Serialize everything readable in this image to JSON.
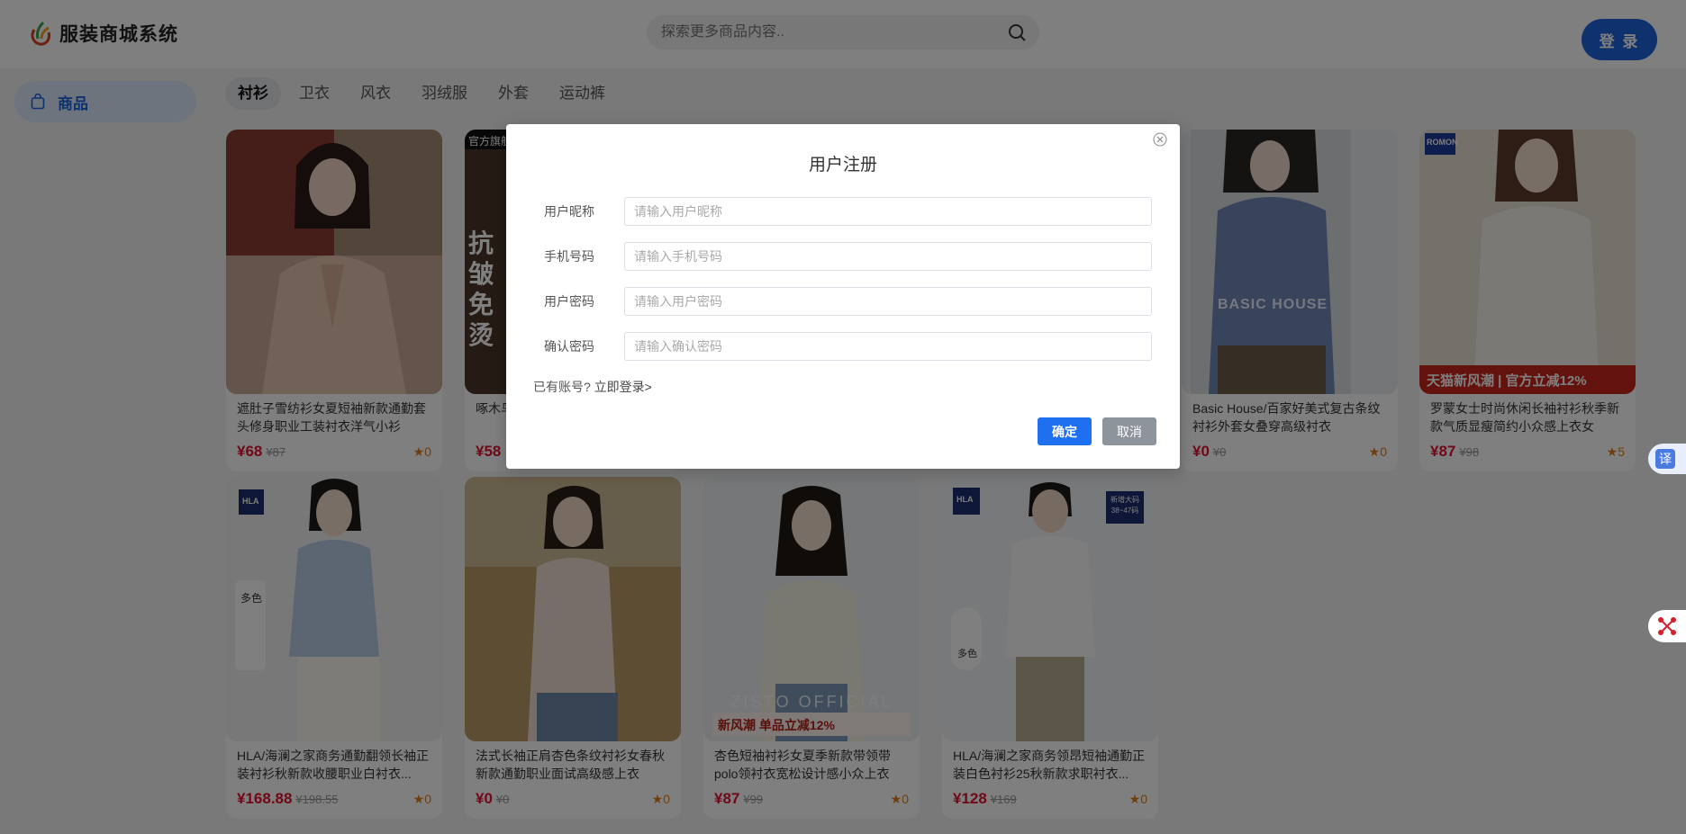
{
  "header": {
    "app_title": "服装商城系统",
    "search_placeholder": "探索更多商品内容..",
    "login_label": "登 录"
  },
  "sidebar": {
    "items": [
      {
        "label": "商品"
      }
    ]
  },
  "tabs": [
    {
      "label": "衬衫",
      "active": true
    },
    {
      "label": "卫衣"
    },
    {
      "label": "风衣"
    },
    {
      "label": "羽绒服"
    },
    {
      "label": "外套"
    },
    {
      "label": "运动裤"
    }
  ],
  "products": [
    {
      "title": "遮肚子雪纺衫女夏短袖新款通勤套头修身职业工装衬衣洋气小衫",
      "price": "¥68",
      "orig": "¥87",
      "fav": "0"
    },
    {
      "title": "啄木鸟正装衬",
      "price": "¥58",
      "orig": "",
      "fav": ""
    },
    {
      "title": "Basic House/百家好美式复古条纹衬衫外套女叠穿高级衬衣",
      "price": "¥0",
      "orig": "¥0",
      "fav": "0"
    },
    {
      "title": "罗蒙女士时尚休闲长袖衬衫秋季新款气质显瘦简约小众感上衣女",
      "price": "¥87",
      "orig": "¥98",
      "fav": "5"
    },
    {
      "title": "HLA/海澜之家商务通勤翻领长袖正装衬衫秋新款收腰职业白衬衣...",
      "price": "¥168.88",
      "orig": "¥198.55",
      "fav": "0"
    },
    {
      "title": "法式长袖正肩杏色条纹衬衫女春秋新款通勤职业面试高级感上衣",
      "price": "¥0",
      "orig": "¥0",
      "fav": "0"
    },
    {
      "title": "杏色短袖衬衫女夏季新款带领带polo领衬衣宽松设计感小众上衣",
      "price": "¥87",
      "orig": "¥99",
      "fav": "0"
    },
    {
      "title": "HLA/海澜之家商务领昂短袖通勤正装白色衬衫25秋新款求职衬衣...",
      "price": "¥128",
      "orig": "¥169",
      "fav": "0"
    }
  ],
  "image_texts": {
    "p2_badge": "官方旗舰",
    "p2_big": "抗皱免烫",
    "p3_brand": "BASIC HOUSE",
    "p4_brand": "ROMON",
    "p4_banner": "天猫新风潮 | 官方立减12%",
    "p5_brand": "HLA",
    "p5_side": "多色",
    "p7_watermark": "ZISTO OFFICIAL",
    "p7_banner": "新风潮 单品立减12%",
    "p8_brand": "HLA",
    "p8_badge": "新增大码 38~47码",
    "p8_side": "多色"
  },
  "float": {
    "translate_label": "译"
  },
  "dialog": {
    "title": "用户注册",
    "fields": [
      {
        "label": "用户昵称",
        "placeholder": "请输入用户昵称"
      },
      {
        "label": "手机号码",
        "placeholder": "请输入手机号码"
      },
      {
        "label": "用户密码",
        "placeholder": "请输入用户密码"
      },
      {
        "label": "确认密码",
        "placeholder": "请输入确认密码"
      }
    ],
    "login_prompt": "已有账号?",
    "login_link": "立即登录>",
    "ok_label": "确定",
    "cancel_label": "取消"
  },
  "colors": {
    "accent": "#1e64dc",
    "price": "#e0112e",
    "star": "#e07a1a",
    "cancel": "#8e949c"
  }
}
